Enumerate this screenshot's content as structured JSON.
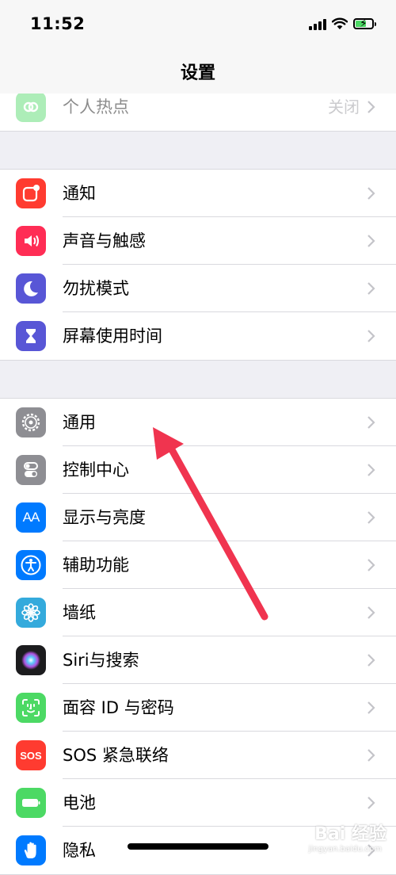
{
  "status_bar": {
    "time": "11:52"
  },
  "nav": {
    "title": "设置"
  },
  "group0": {
    "items": [
      {
        "label": "个人热点",
        "value": "关闭",
        "icon": "hotspot-icon",
        "color": "#4cd964"
      }
    ]
  },
  "group1": {
    "items": [
      {
        "label": "通知",
        "icon": "notifications-icon",
        "color": "#ff3b30"
      },
      {
        "label": "声音与触感",
        "icon": "sound-icon",
        "color": "#ff2d55"
      },
      {
        "label": "勿扰模式",
        "icon": "moon-icon",
        "color": "#5856d6"
      },
      {
        "label": "屏幕使用时间",
        "icon": "hourglass-icon",
        "color": "#5856d6"
      }
    ]
  },
  "group2": {
    "items": [
      {
        "label": "通用",
        "icon": "gear-icon",
        "color": "#8e8e93"
      },
      {
        "label": "控制中心",
        "icon": "switches-icon",
        "color": "#8e8e93"
      },
      {
        "label": "显示与亮度",
        "icon": "text-size-icon",
        "icon_text": "AA",
        "color": "#007aff"
      },
      {
        "label": "辅助功能",
        "icon": "accessibility-icon",
        "color": "#007aff"
      },
      {
        "label": "墙纸",
        "icon": "flower-icon",
        "color": "#34aadc"
      },
      {
        "label": "Siri与搜索",
        "icon": "siri-icon",
        "color": "#000000"
      },
      {
        "label": "面容 ID 与密码",
        "icon": "face-id-icon",
        "color": "#4cd964"
      },
      {
        "label": "SOS 紧急联络",
        "icon": "sos-icon",
        "icon_text": "SOS",
        "color": "#ff3b30"
      },
      {
        "label": "电池",
        "icon": "battery-setting-icon",
        "color": "#4cd964"
      },
      {
        "label": "隐私",
        "icon": "hand-icon",
        "color": "#007aff"
      }
    ]
  },
  "watermark": {
    "text": "Bai 经验",
    "url": "jingyan.baidu.com"
  }
}
